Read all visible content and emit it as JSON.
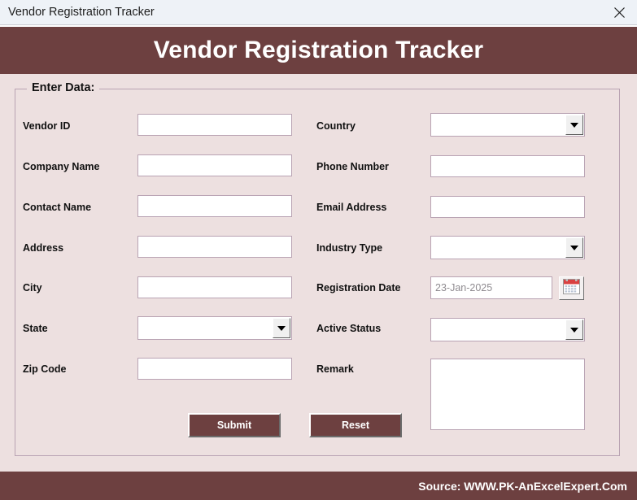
{
  "window": {
    "title": "Vendor Registration Tracker",
    "close_icon": "close-icon"
  },
  "banner": {
    "title": "Vendor Registration Tracker"
  },
  "form": {
    "legend": "Enter Data:",
    "left_fields": [
      {
        "label": "Vendor ID",
        "type": "text",
        "value": "",
        "placeholder": ""
      },
      {
        "label": "Company Name",
        "type": "text",
        "value": "",
        "placeholder": ""
      },
      {
        "label": "Contact Name",
        "type": "text",
        "value": "",
        "placeholder": ""
      },
      {
        "label": "Address",
        "type": "text",
        "value": "",
        "placeholder": ""
      },
      {
        "label": "City",
        "type": "text",
        "value": "",
        "placeholder": ""
      },
      {
        "label": "State",
        "type": "combo",
        "value": ""
      },
      {
        "label": "Zip Code",
        "type": "text",
        "value": "",
        "placeholder": ""
      }
    ],
    "right_fields": [
      {
        "label": "Country",
        "type": "combo",
        "value": ""
      },
      {
        "label": "Phone Number",
        "type": "text",
        "value": "",
        "placeholder": ""
      },
      {
        "label": "Email Address",
        "type": "text",
        "value": "",
        "placeholder": ""
      },
      {
        "label": "Industry Type",
        "type": "combo",
        "value": ""
      },
      {
        "label": "Registration Date",
        "type": "date",
        "value": "",
        "placeholder": "23-Jan-2025",
        "icon": "calendar-icon"
      },
      {
        "label": "Active Status",
        "type": "combo",
        "value": ""
      },
      {
        "label": "Remark",
        "type": "textarea",
        "value": "",
        "placeholder": ""
      }
    ]
  },
  "actions": {
    "submit_label": "Submit",
    "reset_label": "Reset"
  },
  "footer": {
    "source_text": "Source: WWW.PK-AnExcelExpert.Com"
  },
  "colors": {
    "brand": "#6d4040",
    "form_bg": "#ede0e0",
    "titlebar_bg": "#eef2f7",
    "field_border": "#b9a3b3",
    "placeholder": "#8f8b90"
  }
}
